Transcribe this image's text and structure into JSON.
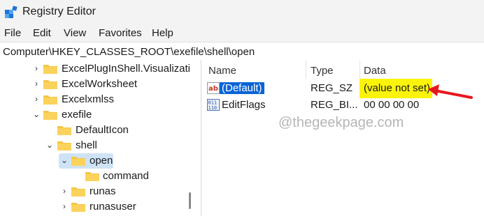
{
  "window": {
    "title": "Registry Editor"
  },
  "menu": [
    "File",
    "Edit",
    "View",
    "Favorites",
    "Help"
  ],
  "address": "Computer\\HKEY_CLASSES_ROOT\\exefile\\shell\\open",
  "tree": [
    {
      "label": "ExcelPlugInShell.Visualizati",
      "expanded": false,
      "has_children": true
    },
    {
      "label": "ExcelWorksheet",
      "expanded": false,
      "has_children": true
    },
    {
      "label": "Excelxmlss",
      "expanded": false,
      "has_children": true
    },
    {
      "label": "exefile",
      "expanded": true,
      "has_children": true
    },
    {
      "label": "DefaultIcon",
      "expanded": false,
      "has_children": false
    },
    {
      "label": "shell",
      "expanded": true,
      "has_children": true
    },
    {
      "label": "open",
      "expanded": true,
      "has_children": true,
      "selected": true
    },
    {
      "label": "command",
      "expanded": false,
      "has_children": false
    },
    {
      "label": "runas",
      "expanded": false,
      "has_children": true
    },
    {
      "label": "runasuser",
      "expanded": false,
      "has_children": true
    }
  ],
  "list": {
    "columns": [
      "Name",
      "Type",
      "Data"
    ],
    "rows": [
      {
        "name": "(Default)",
        "type": "REG_SZ",
        "data": "(value not set)",
        "icon": "string-value-icon",
        "selected": true,
        "highlighted": true
      },
      {
        "name": "EditFlags",
        "type": "REG_BI...",
        "data": "00 00 00 00",
        "icon": "binary-value-icon"
      }
    ]
  },
  "watermark": "@thegeekpage.com",
  "colors": {
    "selection": "#0a64d6",
    "highlight": "#fbf40a",
    "arrow": "#e8171d",
    "folder": "#f6c544"
  }
}
